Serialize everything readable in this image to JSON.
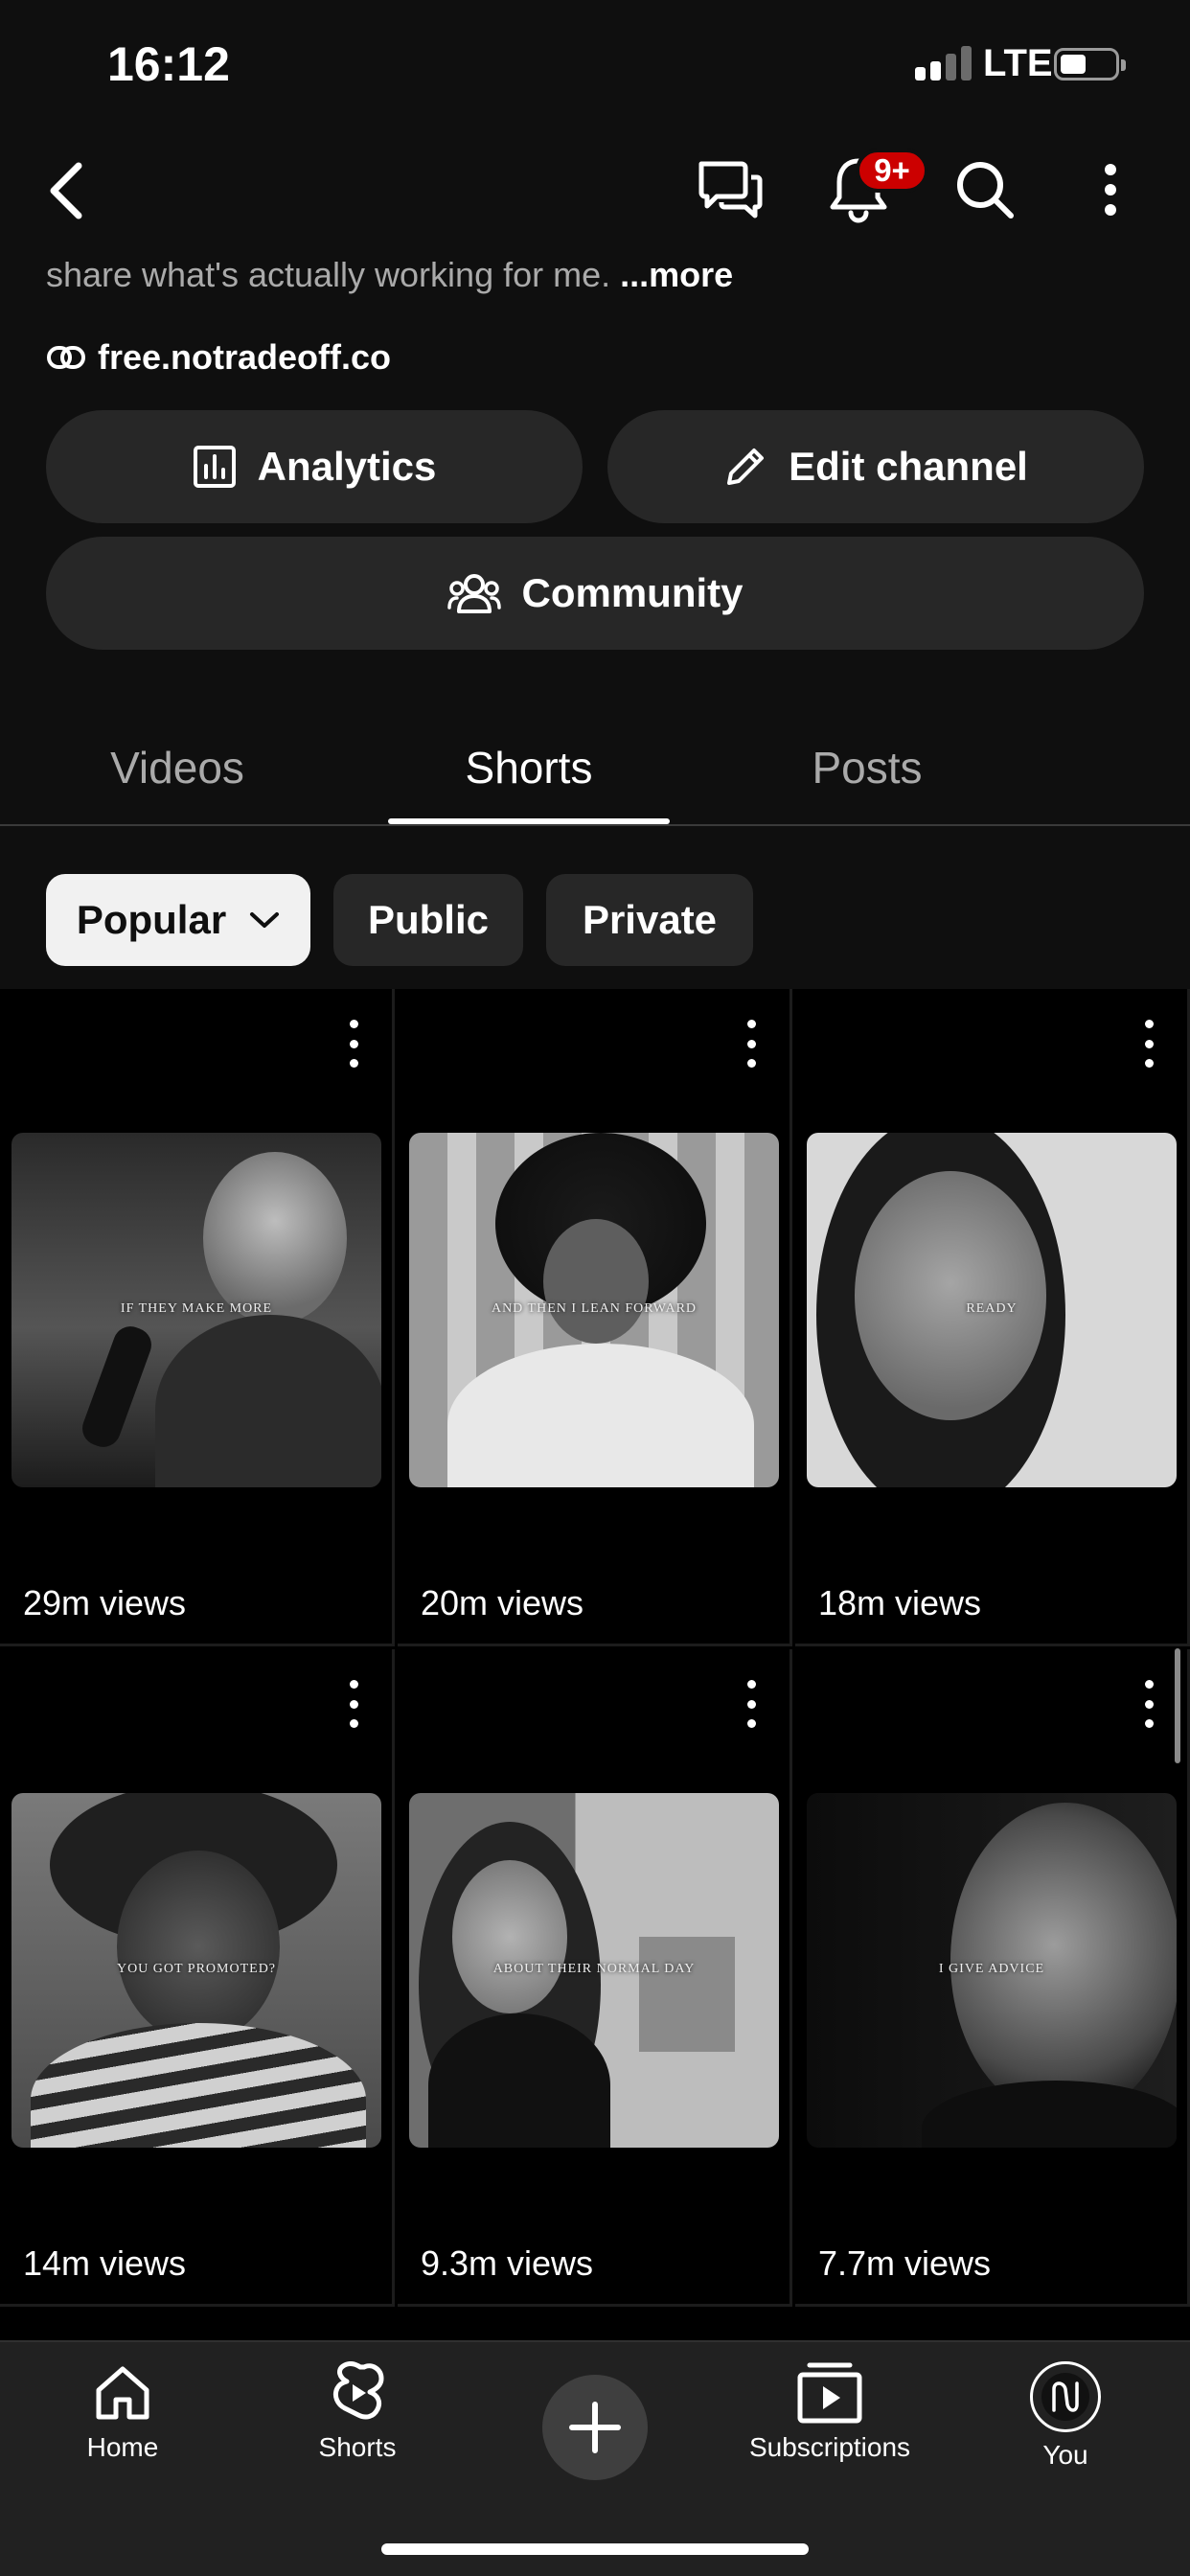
{
  "status_bar": {
    "time": "16:12",
    "network": "LTE"
  },
  "header": {
    "notification_badge": "9+"
  },
  "channel": {
    "description_snippet": "share what's actually working for me.",
    "more_label": "...more",
    "link": "free.notradeoff.co"
  },
  "actions": {
    "analytics_label": "Analytics",
    "edit_channel_label": "Edit channel",
    "community_label": "Community"
  },
  "tabs": [
    {
      "label": "Videos",
      "active": false
    },
    {
      "label": "Shorts",
      "active": true
    },
    {
      "label": "Posts",
      "active": false
    }
  ],
  "filters": [
    {
      "label": "Popular",
      "selected": true
    },
    {
      "label": "Public",
      "selected": false
    },
    {
      "label": "Private",
      "selected": false
    }
  ],
  "shorts": [
    {
      "caption": "IF THEY MAKE MORE",
      "views": "29m views"
    },
    {
      "caption": "AND THEN I LEAN FORWARD",
      "views": "20m views"
    },
    {
      "caption": "READY",
      "views": "18m views"
    },
    {
      "caption": "YOU GOT PROMOTED?",
      "views": "14m views"
    },
    {
      "caption": "ABOUT THEIR NORMAL DAY",
      "views": "9.3m views"
    },
    {
      "caption": "I GIVE ADVICE",
      "views": "7.7m views"
    }
  ],
  "bottom_nav": [
    {
      "label": "Home",
      "icon": "home-icon"
    },
    {
      "label": "Shorts",
      "icon": "shorts-icon"
    },
    {
      "label": "",
      "icon": "create-icon"
    },
    {
      "label": "Subscriptions",
      "icon": "subscriptions-icon"
    },
    {
      "label": "You",
      "icon": "avatar-icon"
    }
  ],
  "colors": {
    "background": "#0f0f0f",
    "chip": "#272727",
    "badge": "#cc0000",
    "nav": "#212121"
  }
}
